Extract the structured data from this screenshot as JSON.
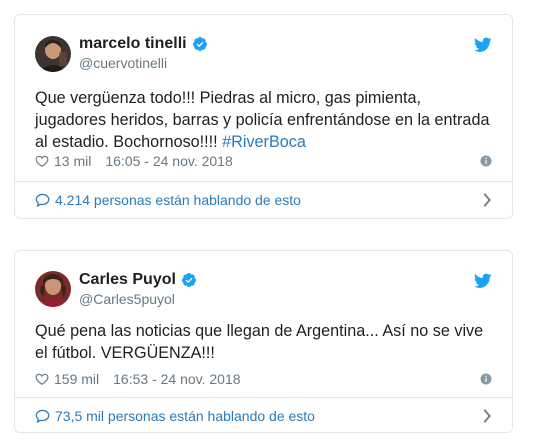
{
  "colors": {
    "accent": "#2b7bb9",
    "twitter_blue": "#1da1f2",
    "text": "#1c2022",
    "muted": "#697882",
    "border": "#e1e8ed"
  },
  "tweets": [
    {
      "name": "marcelo tinelli",
      "handle": "@cuervotinelli",
      "text_main": "Que vergüenza todo!!! Piedras al micro, gas pimienta, jugadores heridos, barras y policía enfrentándose en la entrada al estadio. Bochornoso!!!! ",
      "hashtag": "#RiverBoca",
      "likes": "13 mil",
      "timestamp": "16:05 - 24 nov. 2018",
      "conversation": "4.214 personas están hablando de esto",
      "icons": {
        "verified": "verified-badge-icon",
        "brand": "twitter-bird-icon",
        "like": "heart-icon",
        "info": "info-icon",
        "conversation": "comment-bubble-icon",
        "more": "chevron-right-icon"
      }
    },
    {
      "name": "Carles Puyol",
      "handle": "@Carles5puyol",
      "text_main": "Qué pena las noticias que llegan de Argentina... Así no se vive el fútbol. VERGÜENZA!!!",
      "likes": "159 mil",
      "timestamp": "16:53 - 24 nov. 2018",
      "conversation": "73,5 mil personas están hablando de esto",
      "icons": {
        "verified": "verified-badge-icon",
        "brand": "twitter-bird-icon",
        "like": "heart-icon",
        "info": "info-icon",
        "conversation": "comment-bubble-icon",
        "more": "chevron-right-icon"
      }
    }
  ]
}
